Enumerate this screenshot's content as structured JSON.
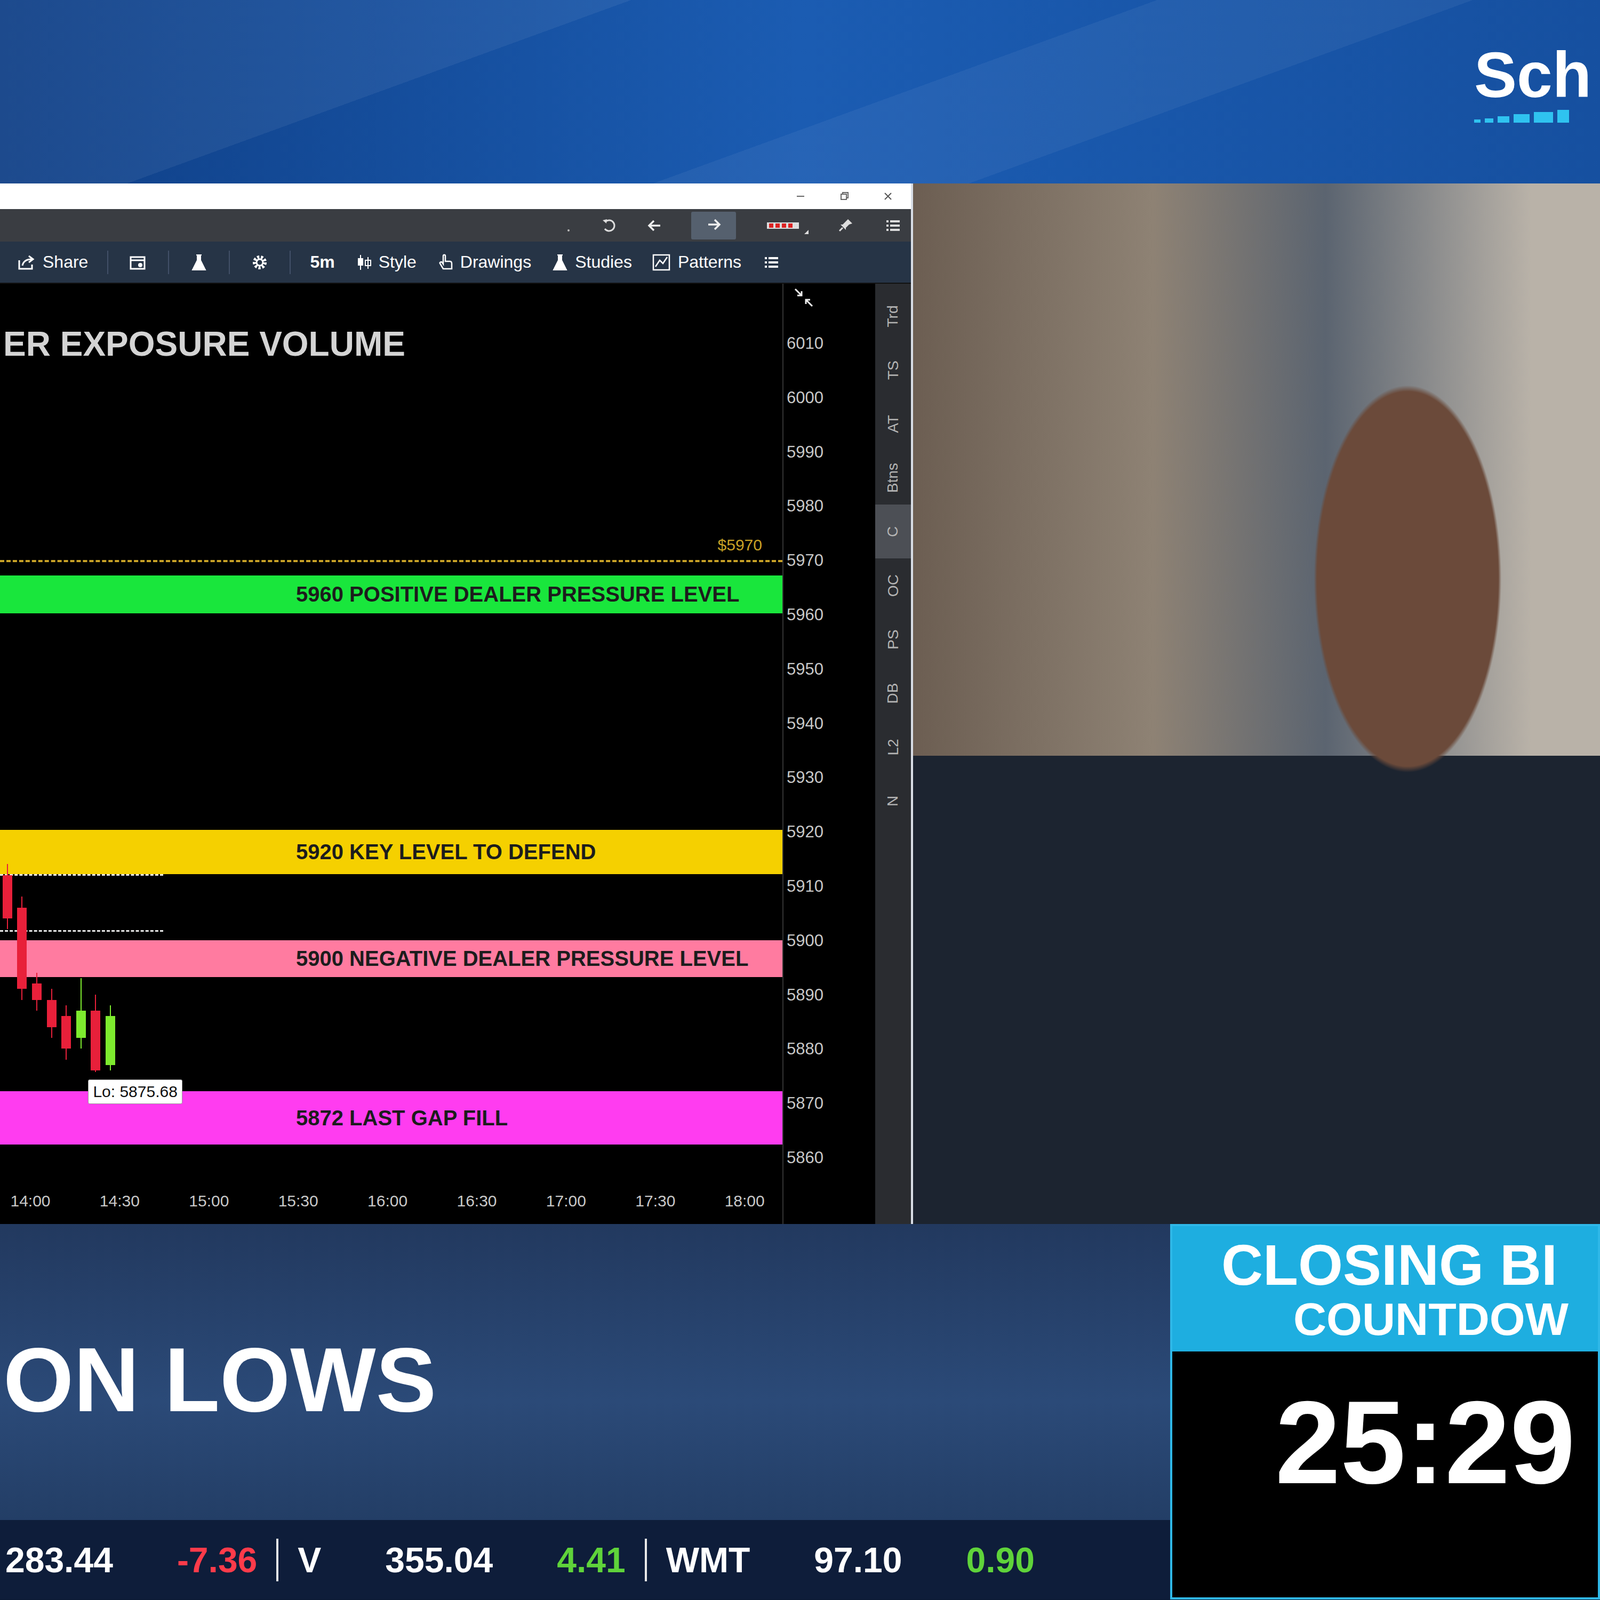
{
  "banner": {
    "logo": "Sch"
  },
  "chart_window": {
    "toolbar": {
      "history_forward_highlighted": true,
      "share": "Share",
      "interval": "5m",
      "style": "Style",
      "drawings": "Drawings",
      "studies": "Studies",
      "patterns": "Patterns"
    },
    "chart": {
      "title": "ER EXPOSURE VOLUME",
      "price_ticks": [
        "6010",
        "6000",
        "5990",
        "5980",
        "5970",
        "5960",
        "5950",
        "5940",
        "5930",
        "5920",
        "5910",
        "5900",
        "5890",
        "5880",
        "5870",
        "5860"
      ],
      "time_ticks": [
        "14:00",
        "14:30",
        "15:00",
        "15:30",
        "16:00",
        "16:30",
        "17:00",
        "17:30",
        "18:00"
      ],
      "reference_line": {
        "price": 5970,
        "label": "$5970",
        "color": "#c9a227"
      },
      "levels": [
        {
          "label": "5960 POSITIVE DEALER PRESSURE LEVEL",
          "range": [
            5967.2,
            5960.2
          ],
          "color": "#19e63c"
        },
        {
          "label": "5920 KEY LEVEL TO DEFEND",
          "range": [
            5920.3,
            5912.2
          ],
          "color": "#f5d000"
        },
        {
          "label": "5900 NEGATIVE DEALER PRESSURE LEVEL",
          "range": [
            5900.0,
            5893.2
          ],
          "color": "#ff7ba0"
        },
        {
          "label": "5872 LAST GAP FILL",
          "range": [
            5872.2,
            5862.4
          ],
          "color": "#ff3cf0"
        }
      ],
      "short_dashes": [
        5912.2,
        5901.9
      ],
      "candles": [
        {
          "open": 5912,
          "high": 5914,
          "low": 5902,
          "close": 5904
        },
        {
          "open": 5906,
          "high": 5908,
          "low": 5889,
          "close": 5891
        },
        {
          "open": 5892,
          "high": 5894,
          "low": 5887,
          "close": 5889
        },
        {
          "open": 5889,
          "high": 5891,
          "low": 5882,
          "close": 5884
        },
        {
          "open": 5886,
          "high": 5888,
          "low": 5878,
          "close": 5880
        },
        {
          "open": 5882,
          "high": 5893,
          "low": 5880,
          "close": 5887
        },
        {
          "open": 5887,
          "high": 5890,
          "low": 5875.68,
          "close": 5876
        },
        {
          "open": 5877,
          "high": 5888,
          "low": 5876,
          "close": 5886
        }
      ],
      "low_marker": {
        "label": "Lo: 5875.68",
        "price": 5875.68,
        "candle": 6
      }
    },
    "side_tabs": [
      {
        "label": "Trd",
        "selected": false
      },
      {
        "label": "TS",
        "selected": false
      },
      {
        "label": "AT",
        "selected": false
      },
      {
        "label": "Btns",
        "selected": false
      },
      {
        "label": "C",
        "selected": true
      },
      {
        "label": "OC",
        "selected": false
      },
      {
        "label": "PS",
        "selected": false
      },
      {
        "label": "DB",
        "selected": false
      },
      {
        "label": "L2",
        "selected": false
      },
      {
        "label": "N",
        "selected": false
      }
    ]
  },
  "lower_third": {
    "headline": "ON LOWS"
  },
  "countdown": {
    "title": "CLOSING BI",
    "subtitle": "COUNTDOW",
    "time": "25:29"
  },
  "ticker": [
    {
      "symbol": "",
      "price": "283.44",
      "change": "-7.36",
      "up": false
    },
    {
      "symbol": "V",
      "price": "355.04",
      "change": "4.41",
      "up": true
    },
    {
      "symbol": "WMT",
      "price": "97.10",
      "change": "0.90",
      "up": true
    }
  ]
}
